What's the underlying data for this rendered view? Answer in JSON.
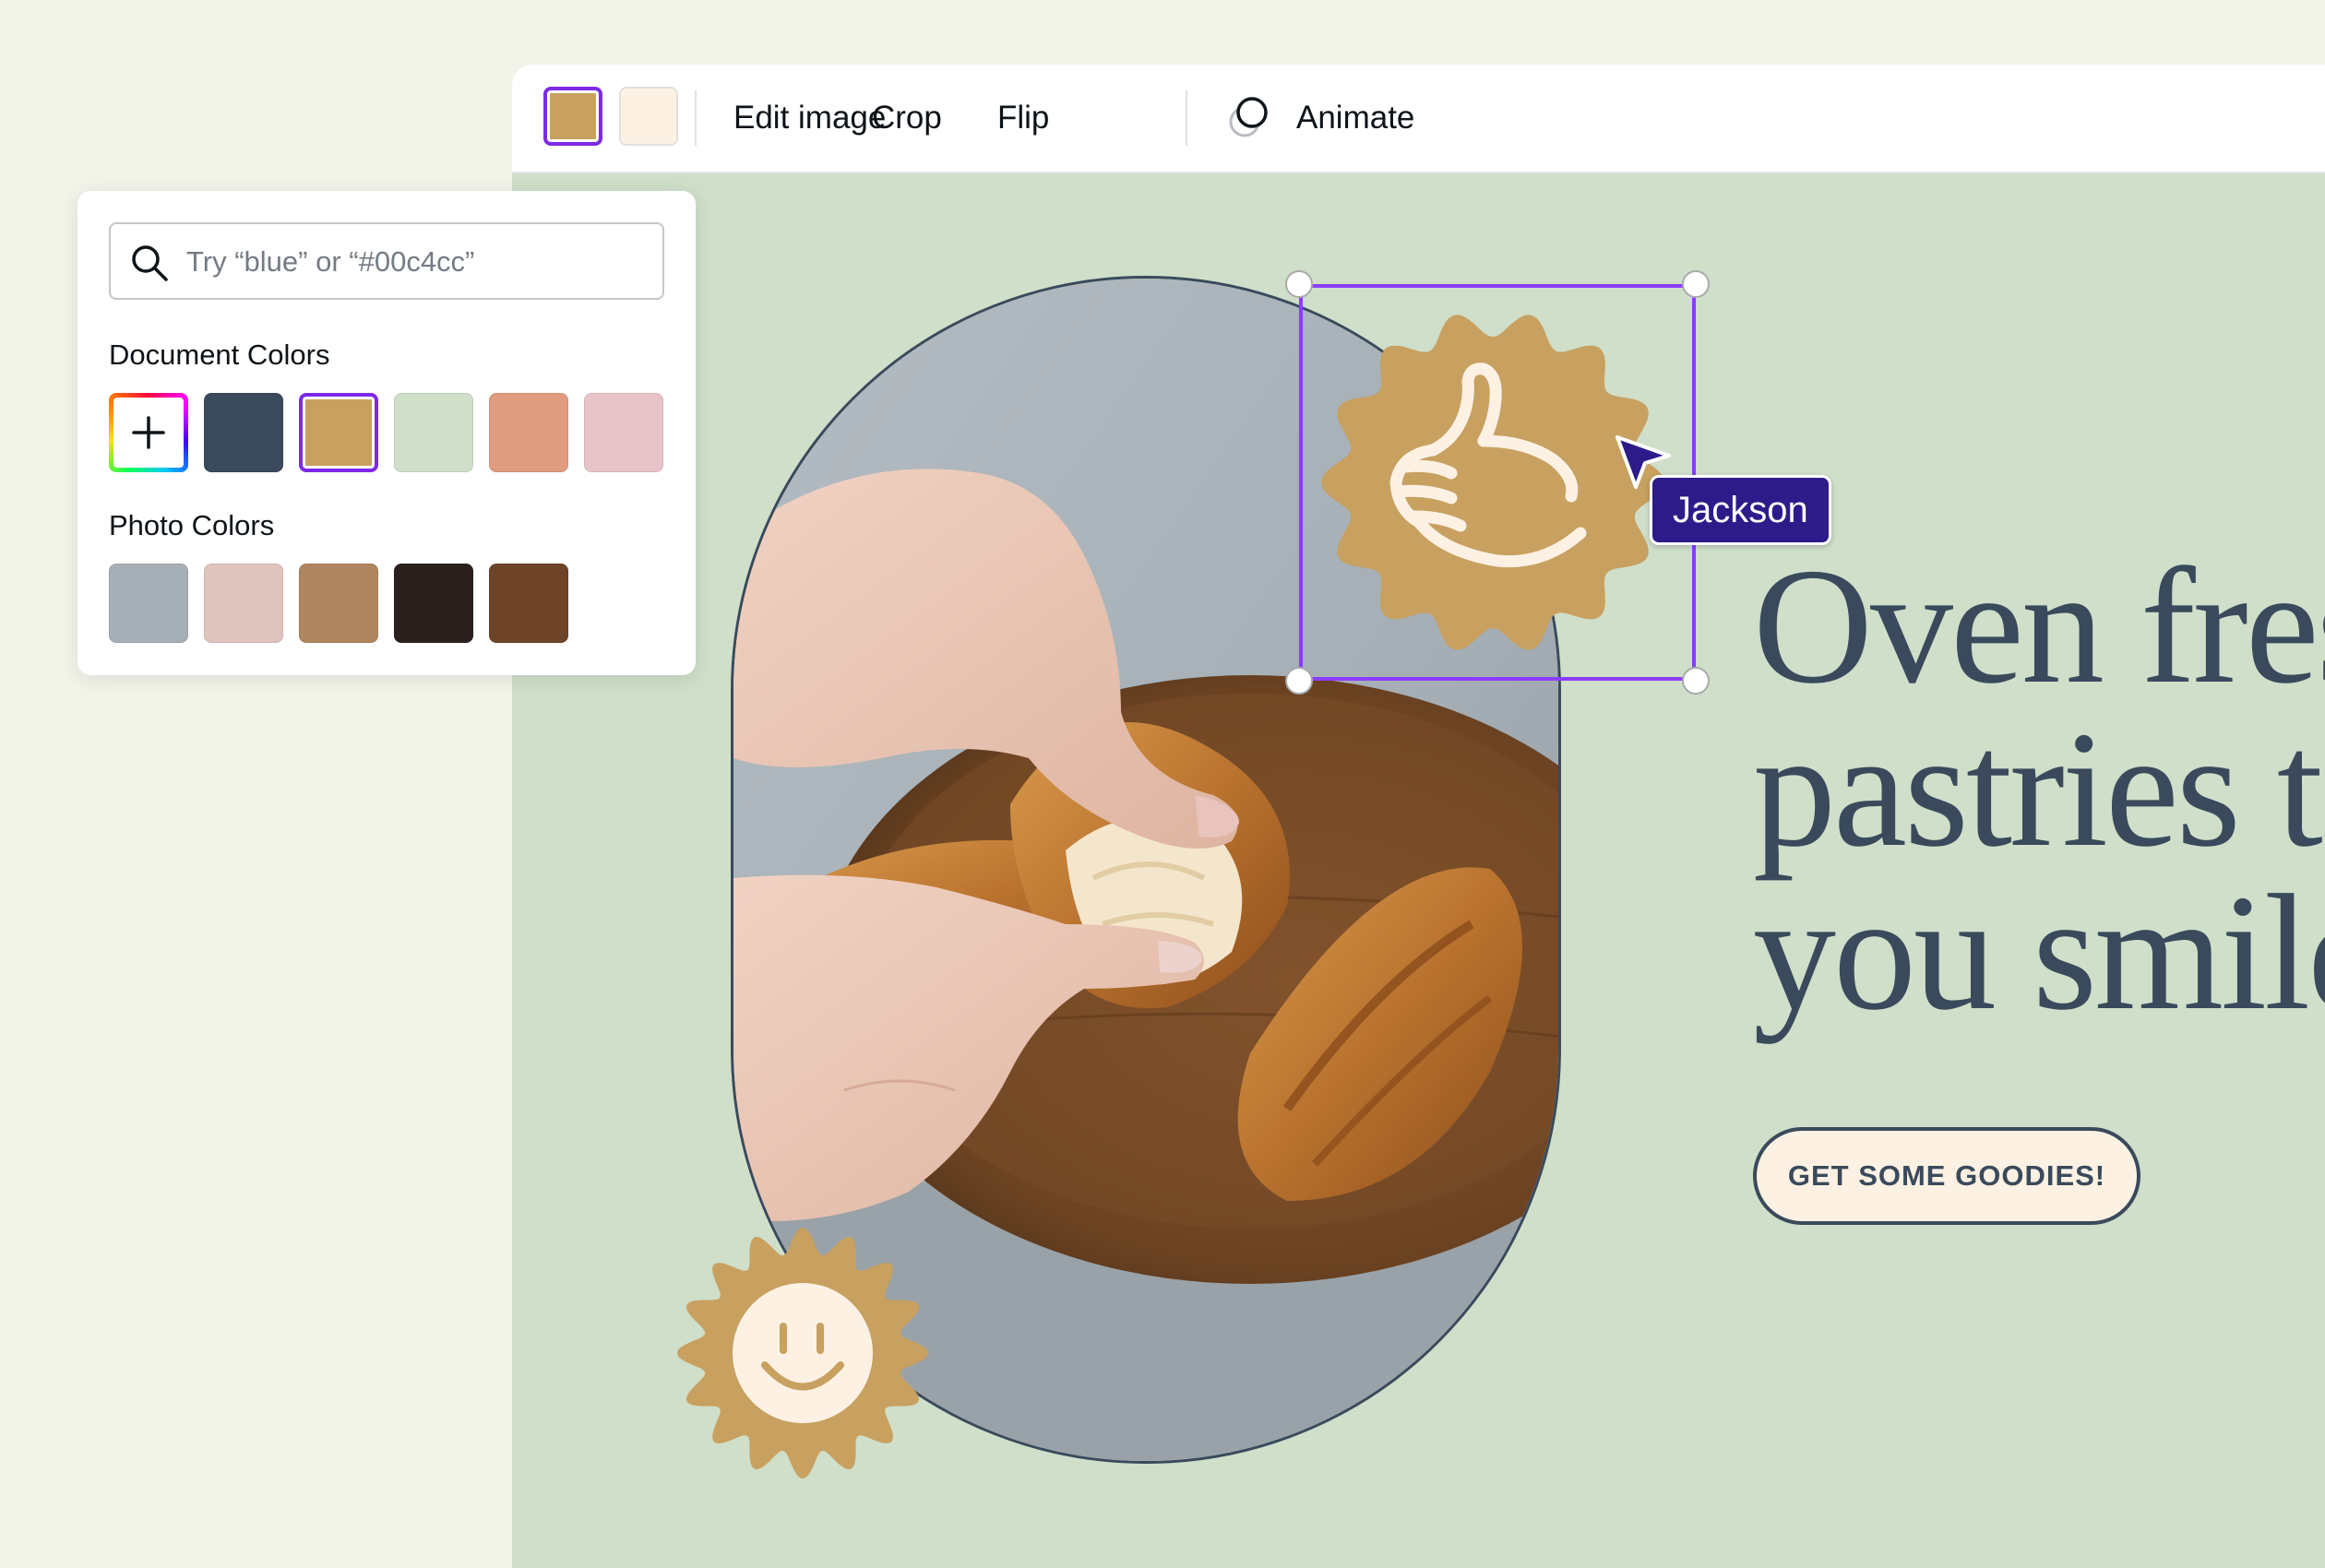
{
  "toolbar": {
    "swatches": [
      {
        "color": "#c8a060",
        "selected": true
      },
      {
        "color": "#fdf1e3",
        "selected": false
      }
    ],
    "edit_image_label": "Edit image",
    "crop_label": "Crop",
    "flip_label": "Flip",
    "animate_label": "Animate"
  },
  "color_panel": {
    "search_placeholder": "Try “blue” or “#00c4cc”",
    "document_colors_label": "Document Colors",
    "document_colors": [
      "#3a4a5c",
      "#c8a060",
      "#cfdfc9",
      "#e09c7e",
      "#e8c4c8"
    ],
    "selected_document_color": "#c8a060",
    "photo_colors_label": "Photo Colors",
    "photo_colors": [
      "#a7afb6",
      "#dfc4bd",
      "#b08660",
      "#2a201e",
      "#6e4428"
    ],
    "add_color_icon": "plus-icon"
  },
  "canvas": {
    "headline_lines": [
      "Oven fres",
      "pastries t",
      "you smile"
    ],
    "cta_label": "GET SOME GOODIES!",
    "collaborator_name": "Jackson",
    "stickers": [
      "thumbs-up-icon",
      "smiley-face-icon"
    ],
    "photo_subject": "hands-tearing-croissant-photo"
  },
  "colors": {
    "canvas_background": "#cfdfc9",
    "text_navy": "#3a4a5c",
    "gold": "#c8a060",
    "cream": "#fdf1e3",
    "selection_purple": "#8b3dff",
    "collaborator_badge": "#2d1b8a"
  }
}
